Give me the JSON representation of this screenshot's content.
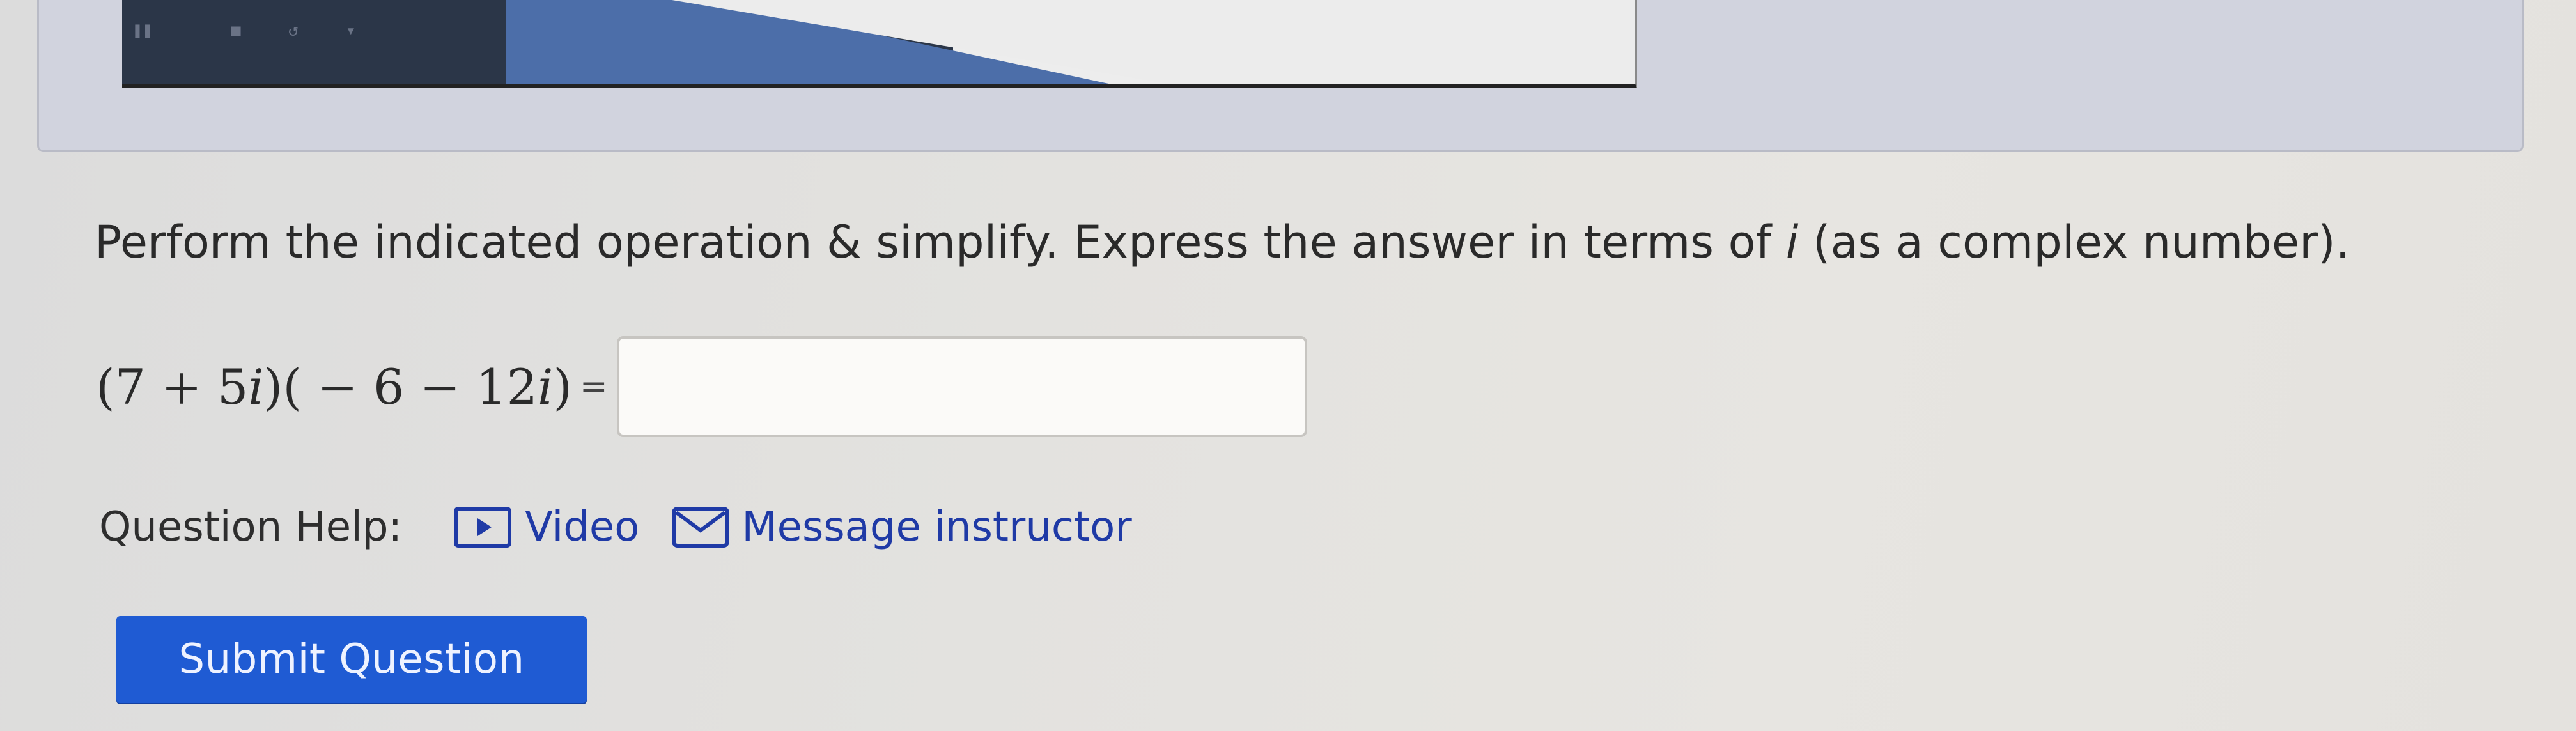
{
  "question": {
    "instruction_text": "Perform the indicated operation & simplify. Express the answer in terms of ",
    "instruction_var": "i",
    "instruction_tail": " (as a complex number).",
    "expression": {
      "part1": "(7 + 5",
      "var1": "i",
      "part2": ")( − 6 − 12",
      "var2": "i",
      "part3": ")"
    },
    "equals": "=",
    "answer": {
      "value": "",
      "placeholder": ""
    }
  },
  "help": {
    "label": "Question Help:",
    "video_label": "Video",
    "message_label": "Message instructor"
  },
  "submit_label": "Submit Question",
  "icons": {
    "video": "video-play-icon",
    "message": "envelope-icon"
  },
  "colors": {
    "accent": "#1f5bd3",
    "link": "#1f3aa6"
  }
}
